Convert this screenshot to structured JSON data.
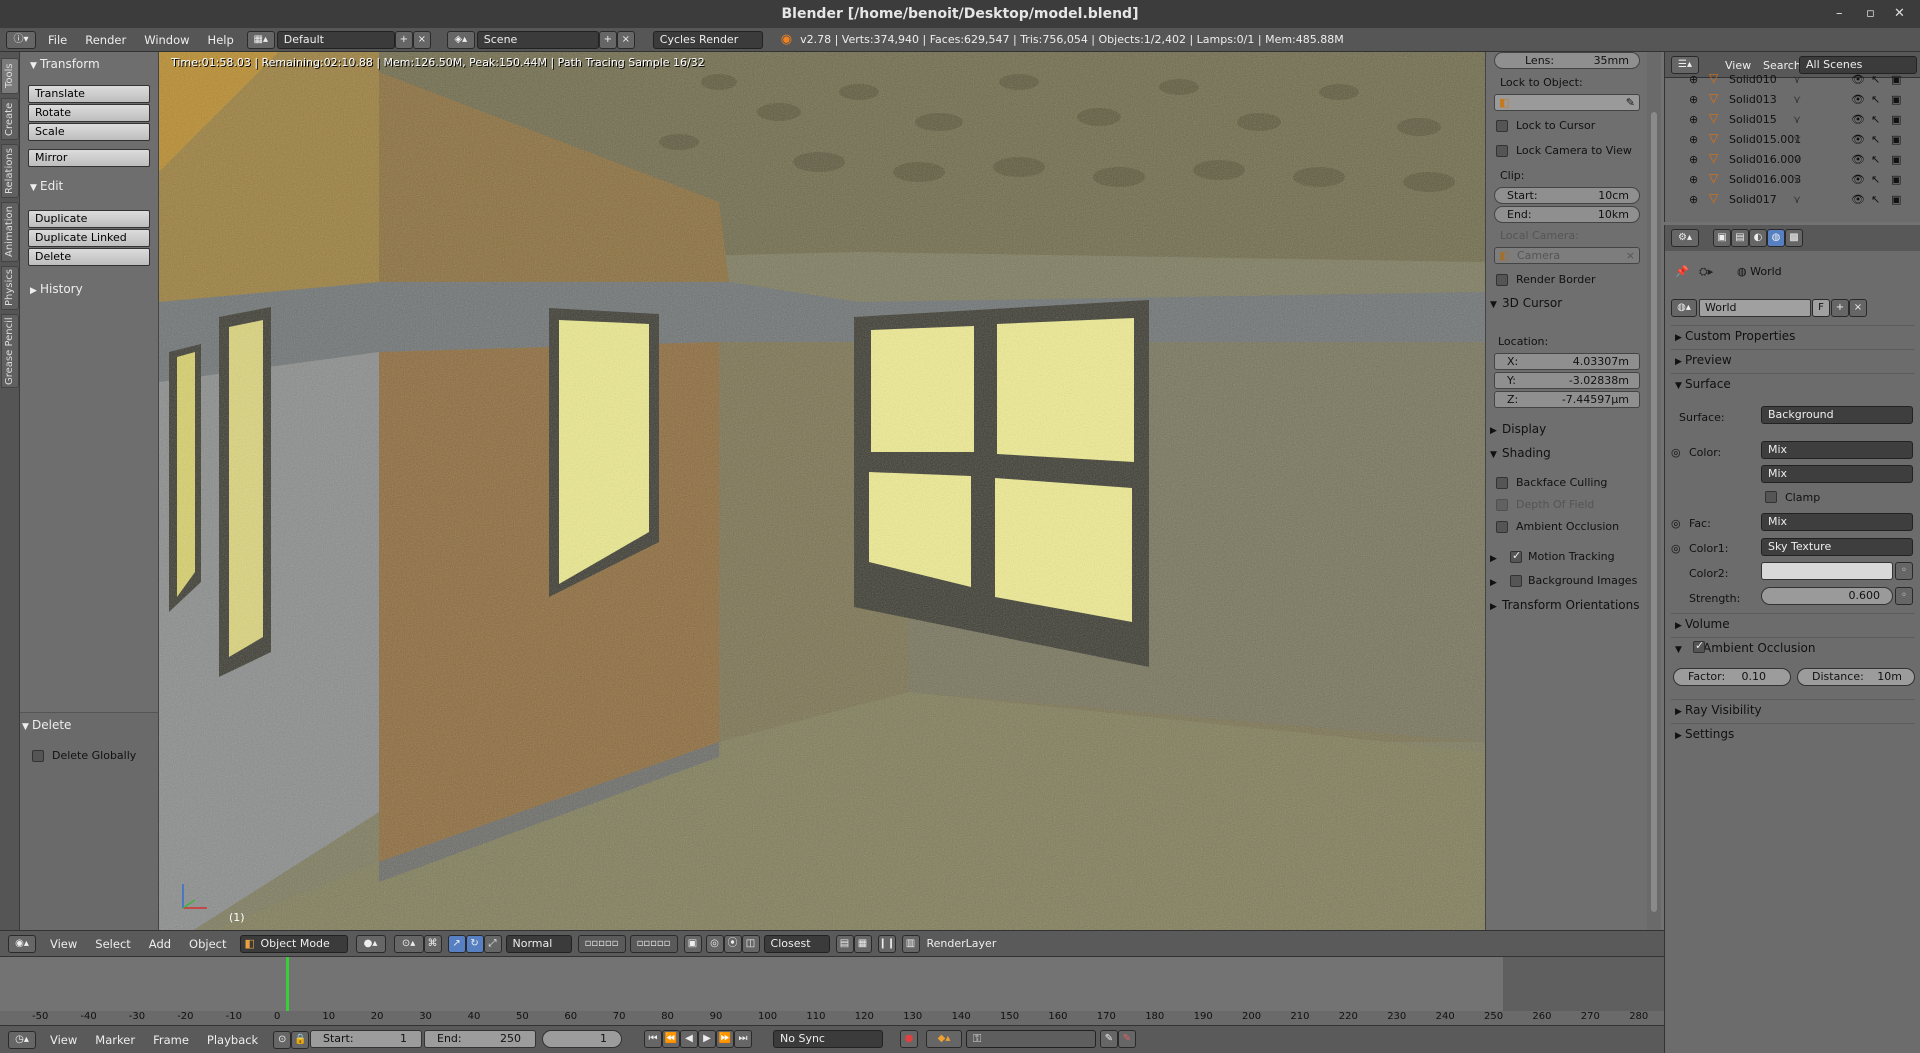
{
  "window": {
    "title": "Blender [/home/benoit/Desktop/model.blend]"
  },
  "info_header": {
    "menus": [
      "File",
      "Render",
      "Window",
      "Help"
    ],
    "layout": "Default",
    "scene": "Scene",
    "engine": "Cycles Render",
    "stats": "v2.78 | Verts:374,940 | Faces:629,547 | Tris:756,054 | Objects:1/2,402 | Lamps:0/1 | Mem:485.88M"
  },
  "tool_tabs": [
    "Tools",
    "Create",
    "Relations",
    "Animation",
    "Physics",
    "Grease Pencil"
  ],
  "tool_shelf": {
    "transform": {
      "title": "Transform",
      "buttons": [
        "Translate",
        "Rotate",
        "Scale",
        "Mirror"
      ]
    },
    "edit": {
      "title": "Edit",
      "buttons": [
        "Duplicate",
        "Duplicate Linked",
        "Delete"
      ]
    },
    "history": "History",
    "operator": {
      "title": "Delete",
      "option": "Delete Globally"
    }
  },
  "viewport": {
    "render_info": "Time:01:58.03 | Remaining:02:10.88 | Mem:126.50M, Peak:150.44M | Path Tracing Sample 16/32",
    "frame": "(1)"
  },
  "n_panel": {
    "lens_label": "Lens:",
    "lens_value": "35mm",
    "lock_to_object": "Lock to Object:",
    "lock_to_cursor": "Lock to Cursor",
    "lock_camera": "Lock Camera to View",
    "clip": "Clip:",
    "clip_start_label": "Start:",
    "clip_start": "10cm",
    "clip_end_label": "End:",
    "clip_end": "10km",
    "local_camera": "Local Camera:",
    "camera_placeholder": "Camera",
    "render_border": "Render Border",
    "cursor_title": "3D Cursor",
    "location": "Location:",
    "x_label": "X:",
    "x": "4.03307m",
    "y_label": "Y:",
    "y": "-3.02838m",
    "z_label": "Z:",
    "z": "-7.44597μm",
    "display": "Display",
    "shading": "Shading",
    "backface": "Backface Culling",
    "dof": "Depth Of Field",
    "ao": "Ambient Occlusion",
    "motion_tracking": "Motion Tracking",
    "background_images": "Background Images",
    "transform_orient": "Transform Orientations"
  },
  "outliner": {
    "menus": [
      "View",
      "Search"
    ],
    "filter": "All Scenes",
    "items": [
      "Solid010",
      "Solid013",
      "Solid015",
      "Solid015.001",
      "Solid016.000",
      "Solid016.003",
      "Solid017"
    ]
  },
  "properties": {
    "breadcrumb": "World",
    "world_name": "World",
    "fake_user": "F",
    "sections": {
      "custom": "Custom Properties",
      "preview": "Preview",
      "surface": "Surface",
      "volume": "Volume",
      "ao": "Ambient Occlusion",
      "ray": "Ray Visibility",
      "settings": "Settings"
    },
    "surface_label": "Surface:",
    "surface_value": "Background",
    "color_label": "Color:",
    "color_value": "Mix",
    "mix_mode": "Mix",
    "clamp": "Clamp",
    "fac_label": "Fac:",
    "fac_value": "Mix",
    "color1_label": "Color1:",
    "color1_value": "Sky Texture",
    "color2_label": "Color2:",
    "strength_label": "Strength:",
    "strength_value": "0.600",
    "factor_label": "Factor:",
    "factor_value": "0.10",
    "distance_label": "Distance:",
    "distance_value": "10m"
  },
  "view3d_header": {
    "menus": [
      "View",
      "Select",
      "Add",
      "Object"
    ],
    "mode": "Object Mode",
    "orientation": "Normal",
    "snap": "Closest",
    "render_layer": "RenderLayer"
  },
  "timeline": {
    "ticks": [
      "-50",
      "-40",
      "-30",
      "-20",
      "-10",
      "0",
      "10",
      "20",
      "30",
      "40",
      "50",
      "60",
      "70",
      "80",
      "90",
      "100",
      "110",
      "120",
      "130",
      "140",
      "150",
      "160",
      "170",
      "180",
      "190",
      "200",
      "210",
      "220",
      "230",
      "240",
      "250",
      "260",
      "270",
      "280"
    ],
    "menus": [
      "View",
      "Marker",
      "Frame",
      "Playback"
    ],
    "start_label": "Start:",
    "start": "1",
    "end_label": "End:",
    "end": "250",
    "current": "1",
    "sync": "No Sync"
  }
}
